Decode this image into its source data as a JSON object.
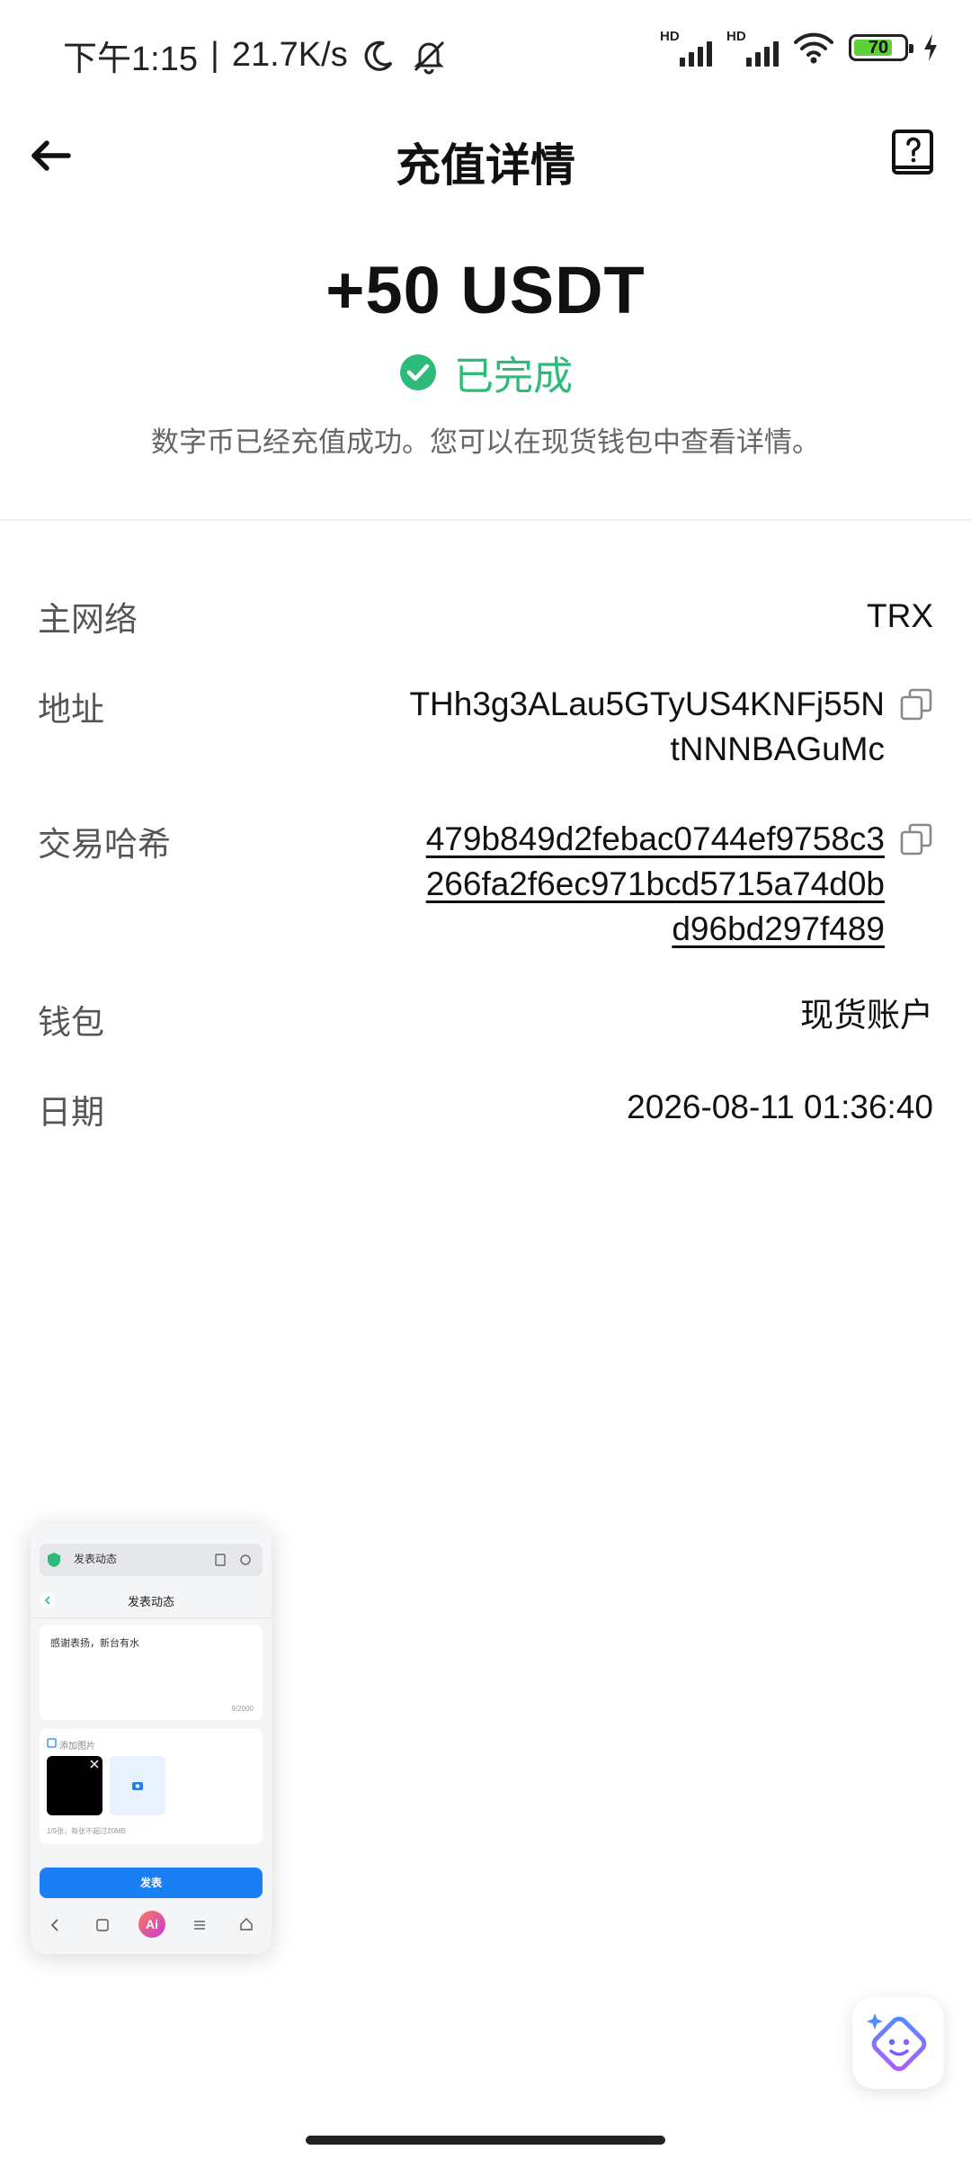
{
  "status_bar": {
    "time": "下午1:15",
    "net_speed": "21.7K/s",
    "hd1": "HD",
    "hd2": "HD",
    "battery": "70"
  },
  "header": {
    "title": "充值详情"
  },
  "summary": {
    "amount": "+50 USDT",
    "status": "已完成",
    "description": "数字币已经充值成功。您可以在现货钱包中查看详情。"
  },
  "details": {
    "network_label": "主网络",
    "network_value": "TRX",
    "address_label": "地址",
    "address_line1": "THh3g3ALau5GTyUS4KNFj55N",
    "address_line2": "tNNNBAGuMc",
    "txhash_label": "交易哈希",
    "txhash_line1": "479b849d2febac0744ef9758c3",
    "txhash_line2": "266fa2f6ec971bcd5715a74d0b",
    "txhash_line3": "d96bd297f489",
    "wallet_label": "钱包",
    "wallet_value": "现货账户",
    "date_label": "日期",
    "date_value": "2026-08-11 01:36:40"
  },
  "preview_card": {
    "bar_title": "发表动态",
    "page_title": "发表动态",
    "post_text": "感谢表扬，新台有水",
    "char_count": "9/2000",
    "add_image_label": "添加图片",
    "image_hint": "1/9张，每张不超过20MB",
    "publish_label": "发表",
    "ai_label": "Ai"
  },
  "colors": {
    "success": "#2dbb7a",
    "text_primary": "#111111",
    "text_secondary": "#555555",
    "accent_blue": "#1a7ff5"
  }
}
